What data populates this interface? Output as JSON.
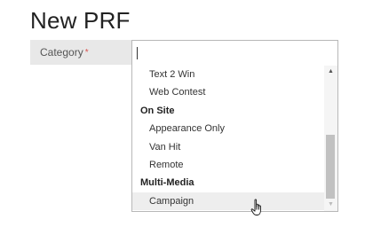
{
  "page": {
    "title": "New PRF"
  },
  "form": {
    "category": {
      "label": "Category",
      "required_marker": "*",
      "search_value": "",
      "options": [
        {
          "label": "Text 2 Win",
          "group": false,
          "hovered": false
        },
        {
          "label": "Web Contest",
          "group": false,
          "hovered": false
        },
        {
          "label": "On Site",
          "group": true,
          "hovered": false
        },
        {
          "label": "Appearance Only",
          "group": false,
          "hovered": false
        },
        {
          "label": "Van Hit",
          "group": false,
          "hovered": false
        },
        {
          "label": "Remote",
          "group": false,
          "hovered": false
        },
        {
          "label": "Multi-Media",
          "group": true,
          "hovered": false
        },
        {
          "label": "Campaign",
          "group": false,
          "hovered": true
        }
      ]
    }
  },
  "icons": {
    "scroll_up": "triangle-up-icon",
    "scroll_down": "triangle-down-icon",
    "cursor": "hand-pointer-icon"
  },
  "colors": {
    "label_bg": "#e8e8e8",
    "required": "#d9534f",
    "hover_bg": "#eeeeee",
    "scroll_thumb": "#c1c1c1"
  }
}
